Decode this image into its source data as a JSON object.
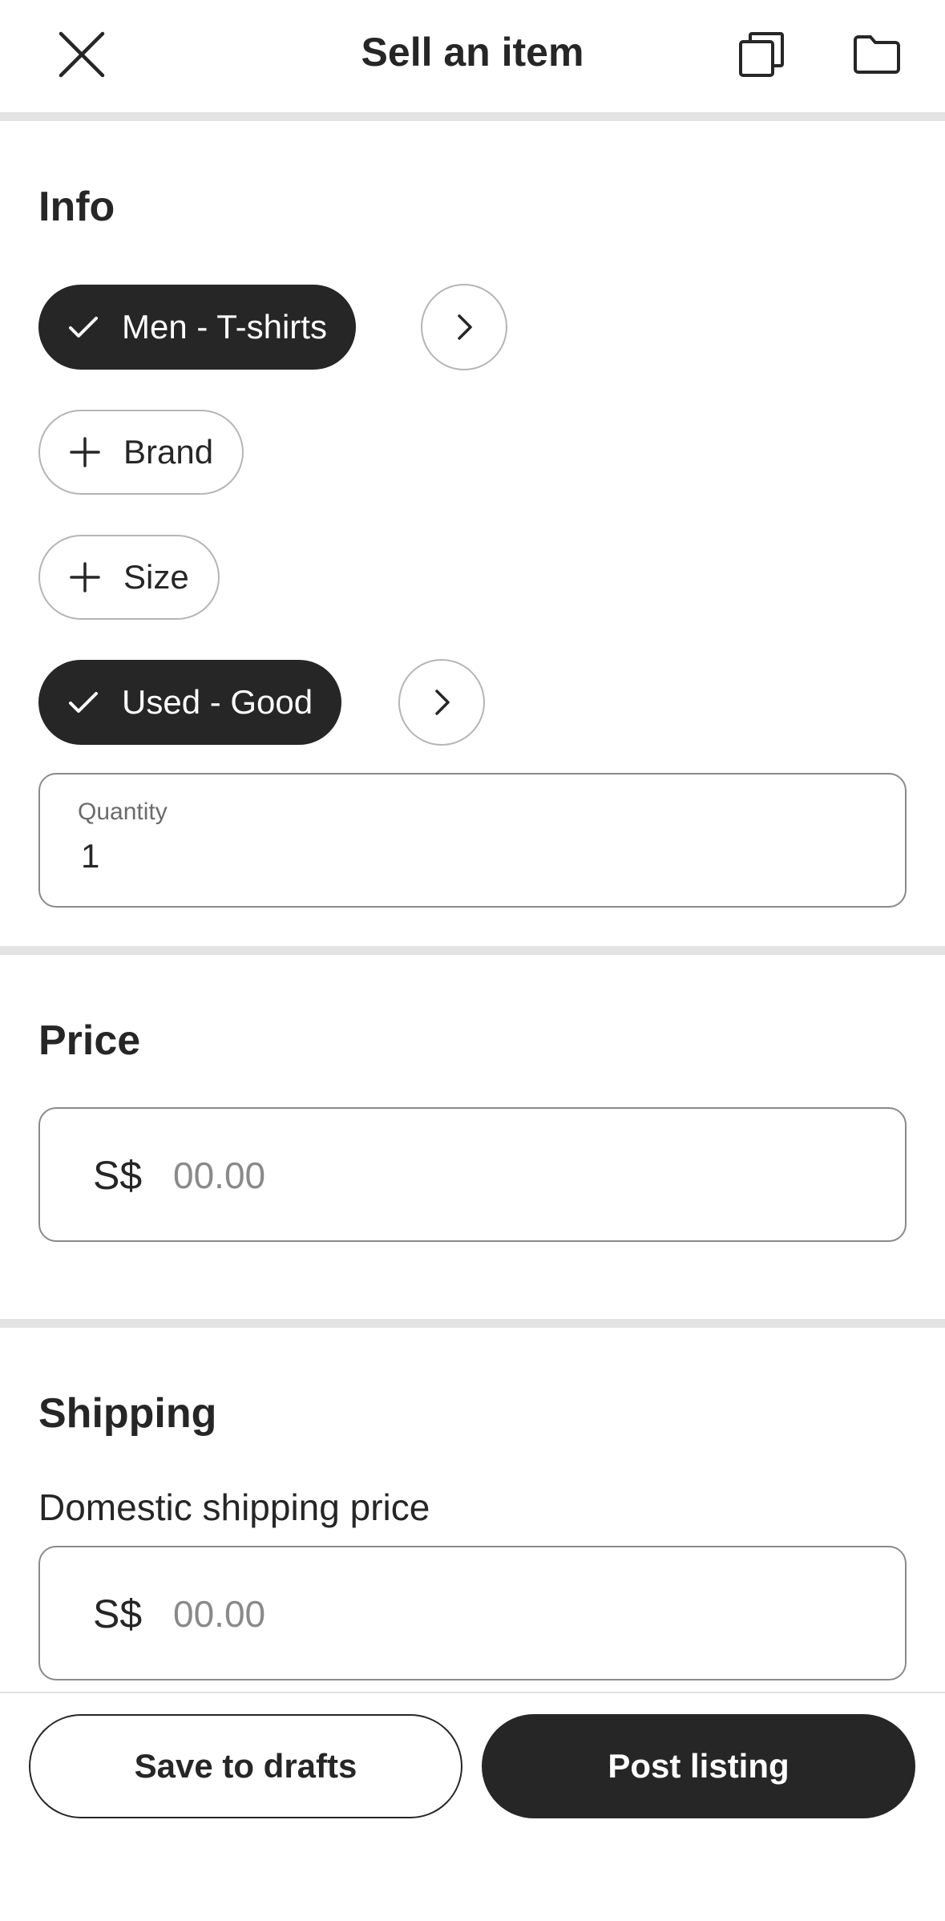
{
  "header": {
    "title": "Sell an item",
    "icons": [
      "close-icon",
      "copy-icon",
      "folder-icon"
    ]
  },
  "info": {
    "title": "Info",
    "category_chip": "Men - T-shirts",
    "brand_chip": "Brand",
    "size_chip": "Size",
    "condition_chip": "Used - Good",
    "quantity_label": "Quantity",
    "quantity_value": "1"
  },
  "price": {
    "title": "Price",
    "currency": "S$",
    "placeholder": "00.00"
  },
  "shipping": {
    "title": "Shipping",
    "domestic_label": "Domestic shipping price",
    "currency": "S$",
    "placeholder": "00.00"
  },
  "actions": {
    "save_label": "Save to drafts",
    "post_label": "Post listing"
  },
  "colors": {
    "primary": "#262626",
    "divider": "#e3e3e3",
    "border": "#b5b5b5"
  }
}
